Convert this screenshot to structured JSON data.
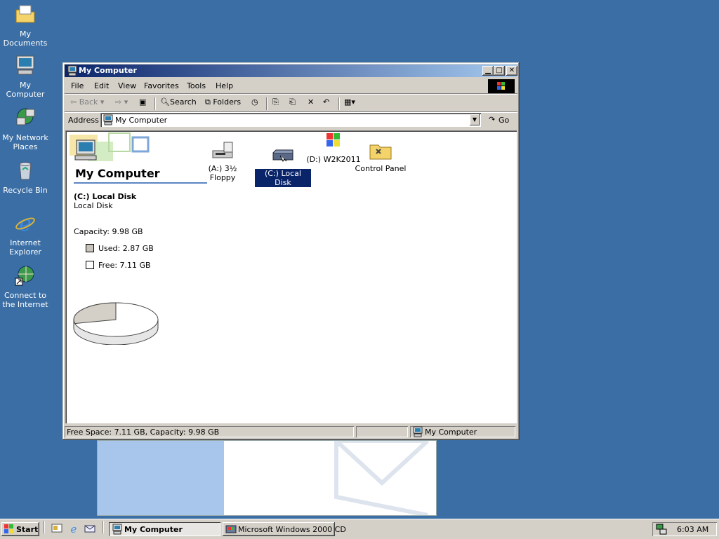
{
  "desktop": {
    "icons": [
      {
        "label": "My Documents",
        "icon": "my-documents-icon"
      },
      {
        "label": "My Computer",
        "icon": "my-computer-icon"
      },
      {
        "label": "My Network Places",
        "icon": "network-places-icon"
      },
      {
        "label": "Recycle Bin",
        "icon": "recycle-bin-icon"
      },
      {
        "label": "Internet Explorer",
        "icon": "internet-explorer-icon"
      },
      {
        "label": "Connect to the Internet",
        "icon": "connect-internet-icon"
      }
    ]
  },
  "window": {
    "title": "My Computer",
    "menu": [
      "File",
      "Edit",
      "View",
      "Favorites",
      "Tools",
      "Help"
    ],
    "toolbar": {
      "back": "Back",
      "search": "Search",
      "folders": "Folders"
    },
    "address_label": "Address",
    "address_value": "My Computer",
    "go_label": "Go",
    "banner_title": "My Computer",
    "drives": [
      {
        "label": "(A:) 3½ Floppy",
        "icon": "floppy-drive-icon",
        "selected": false
      },
      {
        "label": "(C:) Local Disk",
        "icon": "hard-disk-icon",
        "selected": true
      },
      {
        "label": "(D:) W2K2011",
        "icon": "cd-drive-icon",
        "selected": false
      },
      {
        "label": "Control Panel",
        "icon": "control-panel-icon",
        "selected": false
      }
    ],
    "details": {
      "name": "(C:) Local Disk",
      "type": "Local Disk",
      "capacity": "Capacity: 9.98 GB",
      "used": "Used: 2.87 GB",
      "free": "Free: 7.11 GB",
      "used_fraction": 0.2876
    },
    "status": {
      "left": "Free Space: 7.11 GB, Capacity: 9.98 GB",
      "right": "My Computer"
    }
  },
  "taskbar": {
    "start": "Start",
    "tasks": [
      {
        "label": "My Computer",
        "active": true
      },
      {
        "label": "Microsoft Windows 2000 CD",
        "active": false
      }
    ],
    "clock": "6:03 AM"
  },
  "colors": {
    "desktop": "#3a6ea5",
    "title_start": "#0a246a",
    "title_end": "#a6caf0",
    "selection": "#0a246a"
  }
}
